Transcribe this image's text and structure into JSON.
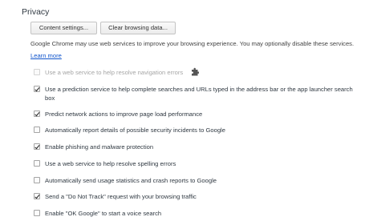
{
  "privacy": {
    "title": "Privacy",
    "buttons": {
      "content_settings": "Content settings...",
      "clear_browsing_data": "Clear browsing data..."
    },
    "description_text": "Google Chrome may use web services to improve your browsing experience. You may optionally disable these services.",
    "learn_more": "Learn more",
    "options": [
      {
        "label": "Use a web service to help resolve navigation errors",
        "checked": false,
        "disabled": true
      },
      {
        "label": "Use a prediction service to help complete searches and URLs typed in the address bar or the app launcher search box",
        "checked": true,
        "disabled": false
      },
      {
        "label": "Predict network actions to improve page load performance",
        "checked": true,
        "disabled": false
      },
      {
        "label": "Automatically report details of possible security incidents to Google",
        "checked": false,
        "disabled": false
      },
      {
        "label": "Enable phishing and malware protection",
        "checked": true,
        "disabled": false
      },
      {
        "label": "Use a web service to help resolve spelling errors",
        "checked": false,
        "disabled": false
      },
      {
        "label": "Automatically send usage statistics and crash reports to Google",
        "checked": false,
        "disabled": false
      },
      {
        "label": "Send a \"Do Not Track\" request with your browsing traffic",
        "checked": true,
        "disabled": false
      },
      {
        "label": "Enable \"OK Google\" to start a voice search",
        "checked": false,
        "disabled": false
      }
    ],
    "extension_icon": "puzzle-piece-icon"
  }
}
